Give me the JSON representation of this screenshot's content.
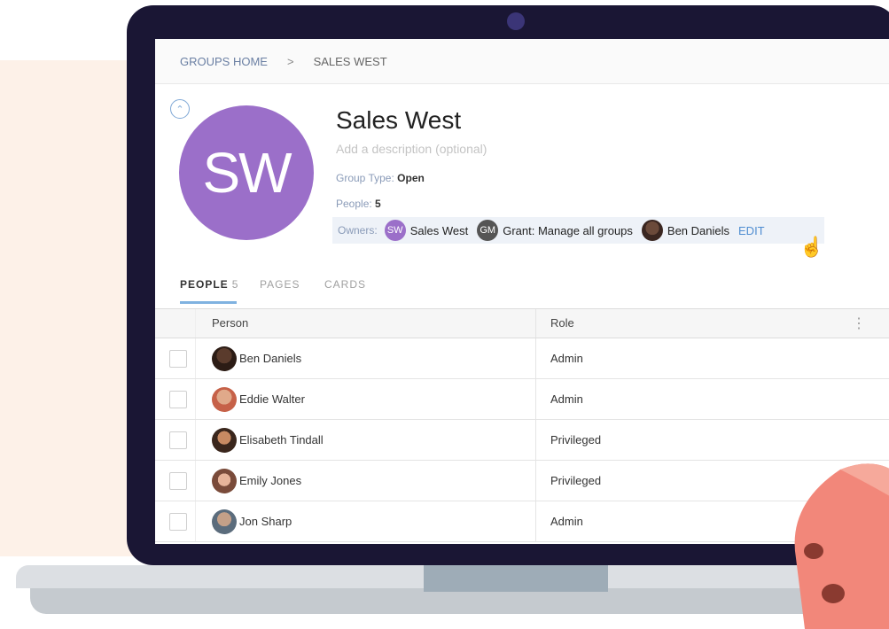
{
  "breadcrumb": {
    "home": "GROUPS HOME",
    "separator": ">",
    "current": "SALES WEST"
  },
  "group": {
    "initials": "SW",
    "title": "Sales West",
    "description_placeholder": "Add a description (optional)",
    "type_label": "Group Type:",
    "type_value": "Open",
    "people_label": "People:",
    "people_value": "5",
    "owners_label": "Owners:",
    "owners": [
      {
        "initials": "SW",
        "name": "Sales West"
      },
      {
        "initials": "GM",
        "name": "Grant: Manage all groups"
      },
      {
        "initials": "",
        "name": "Ben Daniels"
      }
    ],
    "edit_label": "EDIT"
  },
  "tabs": [
    {
      "label": "PEOPLE",
      "count": "5"
    },
    {
      "label": "PAGES"
    },
    {
      "label": "CARDS"
    }
  ],
  "table": {
    "headers": {
      "person": "Person",
      "role": "Role"
    },
    "rows": [
      {
        "name": "Ben Daniels",
        "role": "Admin"
      },
      {
        "name": "Eddie Walter",
        "role": "Admin"
      },
      {
        "name": "Elisabeth Tindall",
        "role": "Privileged"
      },
      {
        "name": "Emily Jones",
        "role": "Privileged"
      },
      {
        "name": "Jon Sharp",
        "role": "Admin"
      }
    ]
  },
  "colors": {
    "avatar": "#9b6fc9",
    "link": "#4f8dd1",
    "laptop_frame": "#1a1634",
    "background_panel": "#fdf1e8"
  },
  "icons": [
    "chevron-up-icon",
    "kebab-menu-icon",
    "hand-cursor-icon"
  ]
}
